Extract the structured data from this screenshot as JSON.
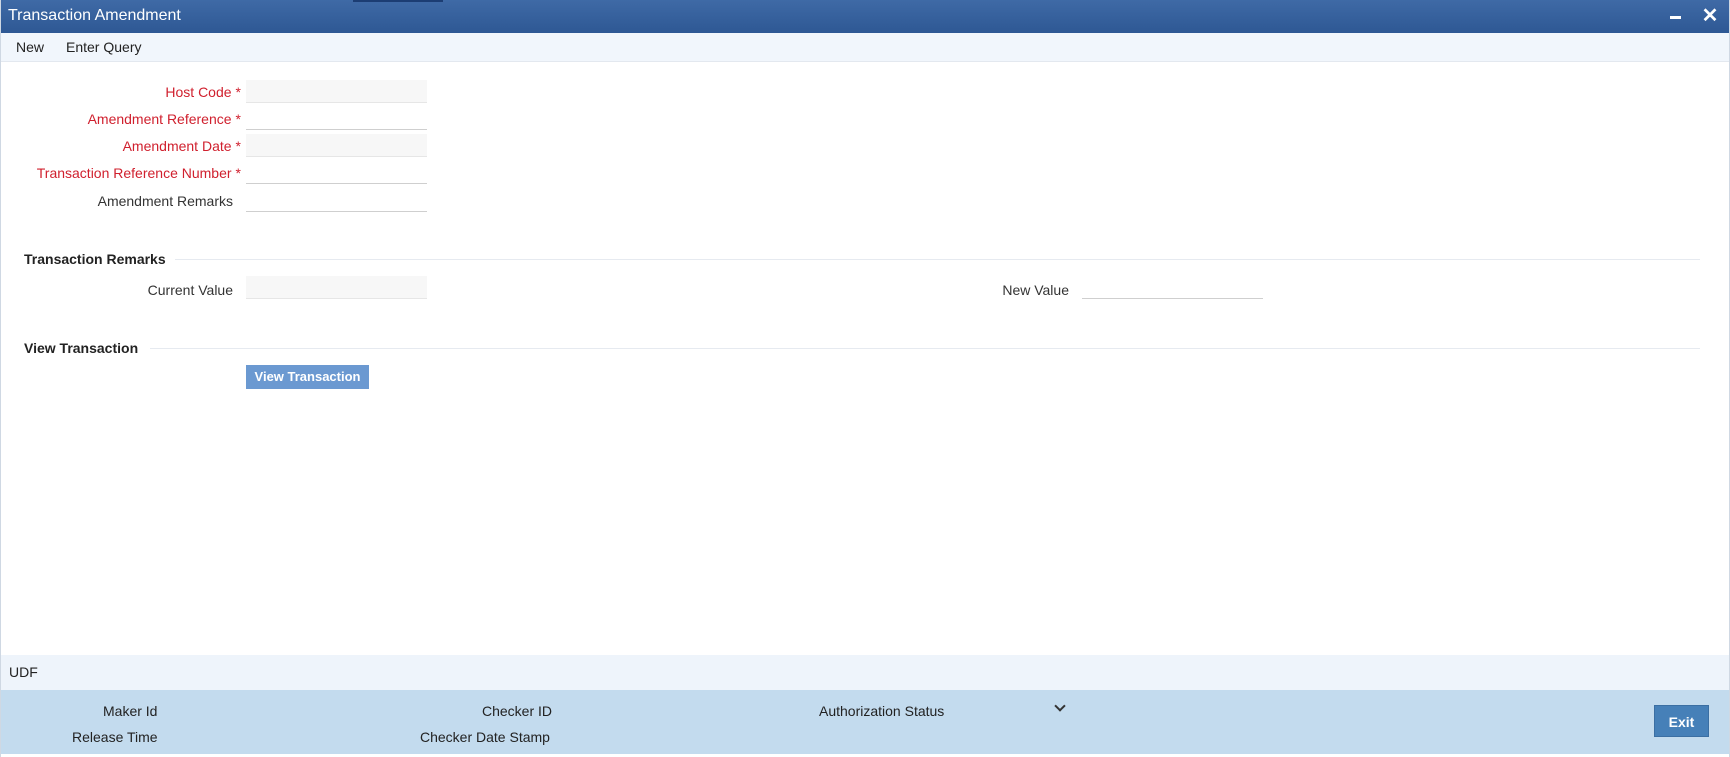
{
  "window": {
    "title": "Transaction Amendment"
  },
  "menu": {
    "new_label": "New",
    "enter_query_label": "Enter Query"
  },
  "form": {
    "host_code_label": "Host Code",
    "amendment_reference_label": "Amendment Reference",
    "amendment_date_label": "Amendment Date",
    "transaction_reference_number_label": "Transaction Reference Number",
    "amendment_remarks_label": "Amendment Remarks",
    "required_marker": "*",
    "host_code_value": "",
    "amendment_reference_value": "",
    "amendment_date_value": "",
    "transaction_reference_number_value": "",
    "amendment_remarks_value": ""
  },
  "transaction_remarks": {
    "section_title": "Transaction Remarks",
    "current_value_label": "Current Value",
    "new_value_label": "New Value",
    "current_value": "",
    "new_value": ""
  },
  "view_transaction": {
    "section_title": "View Transaction",
    "button_label": "View Transaction"
  },
  "udf": {
    "label": "UDF"
  },
  "footer": {
    "maker_id_label": "Maker Id",
    "release_time_label": "Release Time",
    "checker_id_label": "Checker ID",
    "checker_date_stamp_label": "Checker Date Stamp",
    "authorization_status_label": "Authorization Status",
    "exit_label": "Exit"
  },
  "colors": {
    "titlebar": "#2e5894",
    "required": "#d0202e",
    "button": "#6b99d1",
    "footer": "#c3dbee",
    "exit_button": "#4680b8"
  },
  "icons": {
    "minimize": "minimize-icon",
    "close": "close-icon",
    "dropdown": "chevron-down-icon"
  }
}
